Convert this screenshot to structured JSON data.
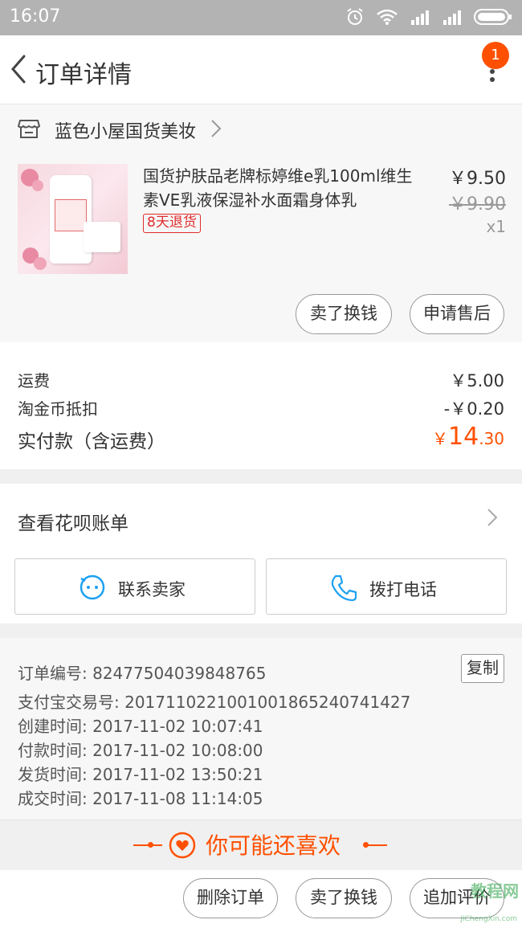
{
  "status_bar": {
    "time": "16:07"
  },
  "navbar": {
    "title": "订单详情",
    "badge_count": "1"
  },
  "shop": {
    "name": "蓝色小屋国货美妆"
  },
  "item": {
    "title": "国货护肤品老牌标婷维e乳100ml维生素VE乳液保湿补水面霜身体乳",
    "tag": "8天退货",
    "price": "￥9.50",
    "original_price": "￥9.90",
    "quantity": "x1",
    "buttons": {
      "sell_for_cash": "卖了换钱",
      "after_sales": "申请售后"
    }
  },
  "costs": {
    "shipping_label": "运费",
    "shipping_value": "￥5.00",
    "coin_label": "淘金币抵扣",
    "coin_value": "-￥0.20",
    "total_label": "实付款（含运费）",
    "total_currency": "￥",
    "total_int": "14",
    "total_dec": ".30"
  },
  "huabei": {
    "label": "查看花呗账单"
  },
  "actions": {
    "contact_seller": "联系卖家",
    "call_phone": "拨打电话"
  },
  "order_info": {
    "order_no": "订单编号: 82477504039848765",
    "copy_label": "复制",
    "alipay_no": "支付宝交易号: 2017110221001001865240741427",
    "created": "创建时间: 2017-11-02 10:07:41",
    "paid": "付款时间: 2017-11-02 10:08:00",
    "shipped": "发货时间: 2017-11-02 13:50:21",
    "completed": "成交时间: 2017-11-08 11:14:05"
  },
  "recommend": {
    "label": "你可能还喜欢"
  },
  "bottom_bar": {
    "delete_order": "删除订单",
    "sell_for_cash": "卖了换钱",
    "review": "追加评价"
  },
  "watermark": {
    "main": "教程网",
    "sub": "JiChengXin.com"
  },
  "colors": {
    "accent": "#ff5000",
    "tag_red": "#e02c2c",
    "icon_blue": "#1da1f2"
  }
}
